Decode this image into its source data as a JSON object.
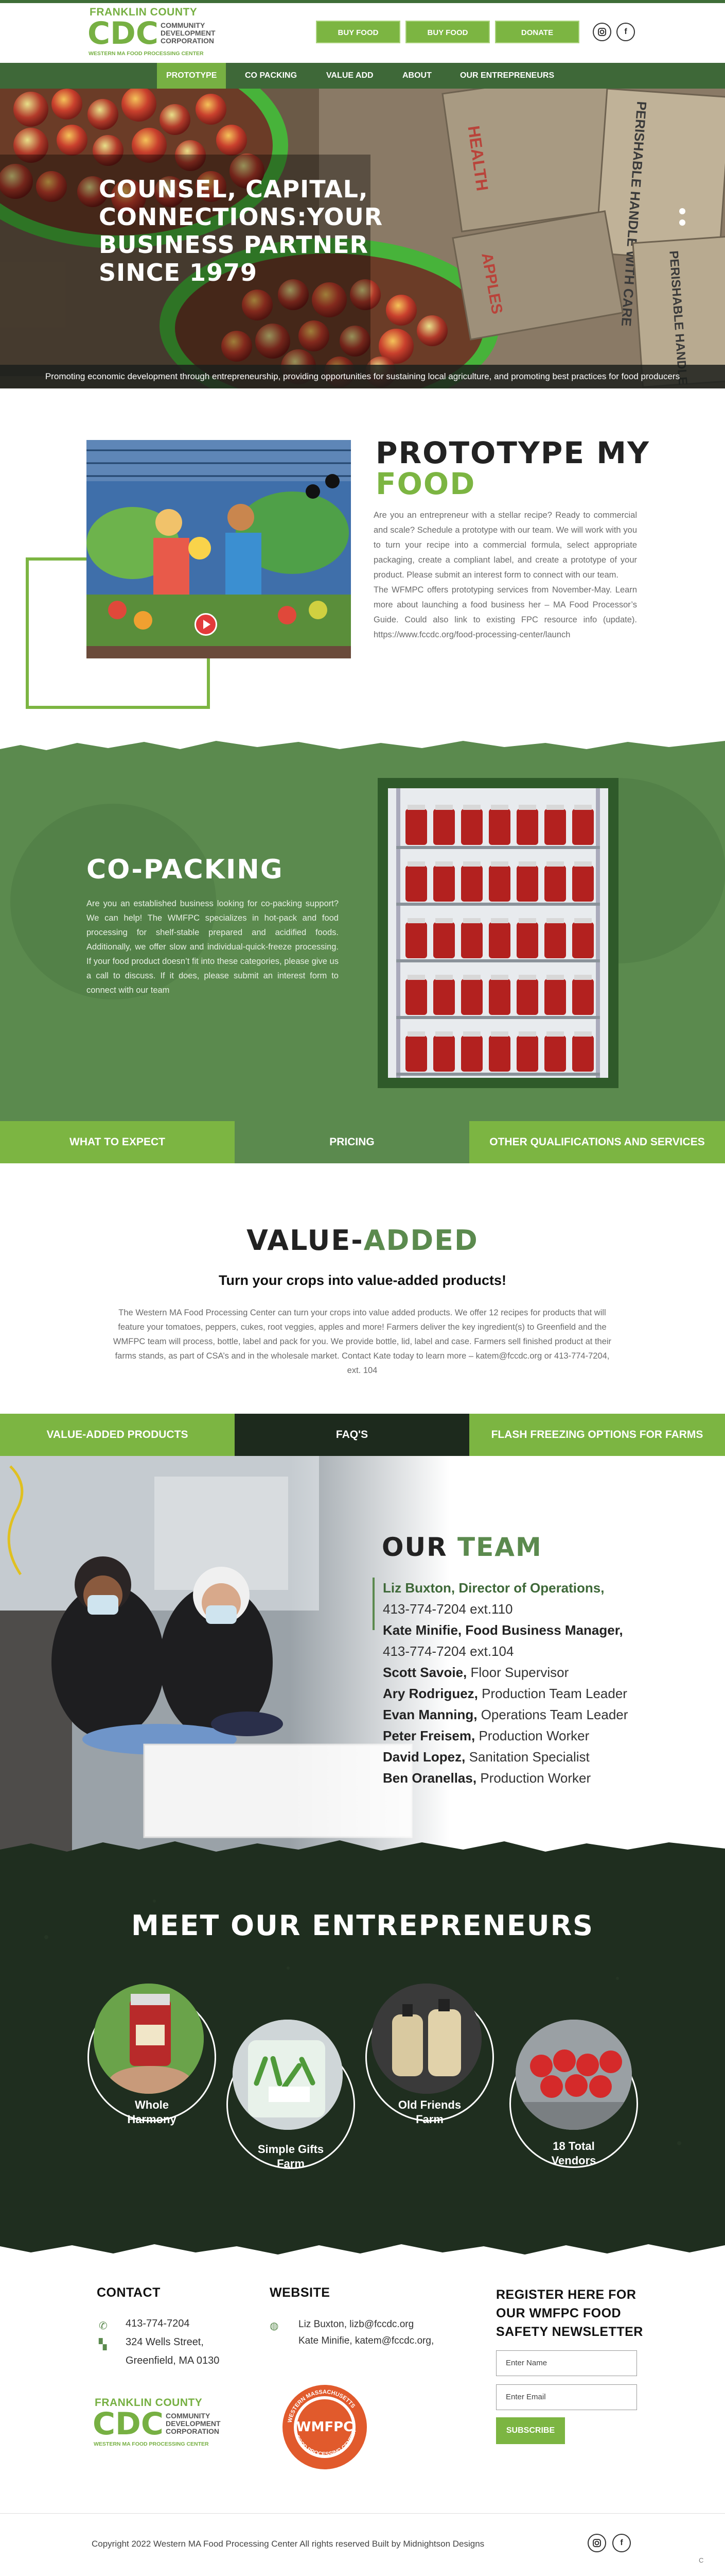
{
  "header": {
    "logo": {
      "line1": "FRANKLIN COUNTY",
      "big": "CDC",
      "sub1": "COMMUNITY",
      "sub2": "DEVELOPMENT",
      "sub3": "CORPORATION",
      "tag": "WESTERN MA FOOD PROCESSING CENTER"
    },
    "buttons": [
      "BUY FOOD",
      "BUY FOOD",
      "DONATE"
    ],
    "social": {
      "instagram": "instagram-icon",
      "facebook": "facebook-icon"
    }
  },
  "nav": {
    "items": [
      "PROTOTYPE",
      "CO PACKING",
      "VALUE ADD",
      "ABOUT",
      "OUR ENTREPRENEURS"
    ],
    "active": 0
  },
  "hero": {
    "headline": [
      "COUNSEL, CAPITAL,",
      "CONNECTIONS:YOUR",
      "BUSINESS PARTNER",
      "SINCE 1979"
    ],
    "box_labels": [
      "HEALTH",
      "PERISHABLE HANDLE WITH CARE",
      "PERISHABLE HANDLE WITH CARE",
      "APPLES"
    ],
    "caption": "Promoting economic development through entrepreneurship, providing opportunities for sustaining local agriculture, and promoting best practices for food producers"
  },
  "prototype": {
    "title1": "PROTOTYPE MY",
    "title2": "FOOD",
    "p1": "Are you an entrepreneur with a stellar recipe? Ready to commercial and scale? Schedule a prototype with our team. We will work with you to turn your recipe into a commercial formula, select appropriate packaging, create a compliant label, and create a prototype of your product. Please submit an interest form to connect with our team.",
    "p2": "The WFMPC offers prototyping services from November-May. Learn more about launching a food business her – MA Food Processor’s Guide. Could also link to existing FPC resource info (update). https://www.fccdc.org/food-processing-center/launch"
  },
  "copacking": {
    "title": "CO-PACKING",
    "text": "Are you an established business looking for co-packing support? We can help! The WMFPC specializes in hot-pack and food processing for shelf-stable prepared and acidified foods. Additionally, we offer slow and individual-quick-freeze processing. If your food product doesn’t fit into these categories, please give us a call to discuss. If it does, please submit an interest form to connect with our team"
  },
  "tabs1": [
    "WHAT TO EXPECT",
    "PRICING",
    "OTHER QUALIFICATIONS AND SERVICES"
  ],
  "value_added": {
    "title1": "VALUE-",
    "title2": "ADDED",
    "subtitle": "Turn your crops into value-added products!",
    "text": "The Western MA Food Processing Center can turn your crops into value added products. We offer 12 recipes for products that will feature your tomatoes, peppers, cukes, root veggies, apples and more! Farmers deliver the key ingredient(s) to Greenfield and the WMFPC team will process, bottle, label and pack for you. We provide bottle, lid, label and case. Farmers sell finished product at their farms stands, as part of CSA’s and in the wholesale market. Contact Kate today to learn more – katem@fccdc.org or 413-774-7204, ext. 104"
  },
  "tabs2": [
    "VALUE-ADDED PRODUCTS",
    "FAQ'S",
    "FLASH FREEZING OPTIONS FOR FARMS"
  ],
  "team": {
    "title1": "OUR",
    "title2": "TEAM",
    "members": [
      {
        "name": "Liz Buxton, Director of Operations,",
        "role": "",
        "phone": "413-774-7204 ext.110"
      },
      {
        "name": "Kate Minifie, Food Business Manager,",
        "role": "",
        "phone": "413-774-7204 ext.104"
      },
      {
        "name": "Scott Savoie,",
        "role": "Floor Supervisor",
        "phone": ""
      },
      {
        "name": "Ary Rodriguez,",
        "role": "Production Team Leader",
        "phone": ""
      },
      {
        "name": "Evan Manning,",
        "role": "Operations Team Leader",
        "phone": ""
      },
      {
        "name": "Peter Freisem,",
        "role": "Production Worker",
        "phone": ""
      },
      {
        "name": "David Lopez,",
        "role": "Sanitation Specialist",
        "phone": ""
      },
      {
        "name": "Ben Oranellas,",
        "role": "Production Worker",
        "phone": ""
      }
    ]
  },
  "entrepreneurs": {
    "title": "MEET OUR ENTREPRENEURS",
    "items": [
      {
        "name1": "Whole",
        "name2": "Harmony"
      },
      {
        "name1": "Simple Gifts",
        "name2": "Farm"
      },
      {
        "name1": "Old Friends",
        "name2": "Farm"
      },
      {
        "name1": "18 Total",
        "name2": "Vendors"
      }
    ]
  },
  "footer": {
    "contact_title": "CONTACT",
    "phone": "413-774-7204",
    "address1": "324 Wells Street,",
    "address2": "Greenfield, MA 0130",
    "website_title": "WEBSITE",
    "email1": "Liz Buxton, lizb@fccdc.org",
    "email2": "Kate Minifie, katem@fccdc.org,",
    "newsletter_title": [
      "REGISTER HERE FOR",
      "OUR WMFPC FOOD",
      "SAFETY NEWSLETTER"
    ],
    "name_placeholder": "Enter Name",
    "email_placeholder": "Enter Email",
    "subscribe": "SUBSCRIBE",
    "badge_top": "WESTERN MASSACHUSETTS",
    "badge_mid": "WMFPC",
    "badge_bottom": "FOOD PROCESSING CENTER",
    "copyright": "Copyright 2022 Western MA Food Processing Center All rights reserved Built by Midnightson Designs",
    "corner_mark": "C"
  },
  "colors": {
    "dark_green": "#3e6838",
    "light_green": "#7cb542",
    "mid_green": "#5b8a4e",
    "dark_bg": "#1f2e1f"
  }
}
